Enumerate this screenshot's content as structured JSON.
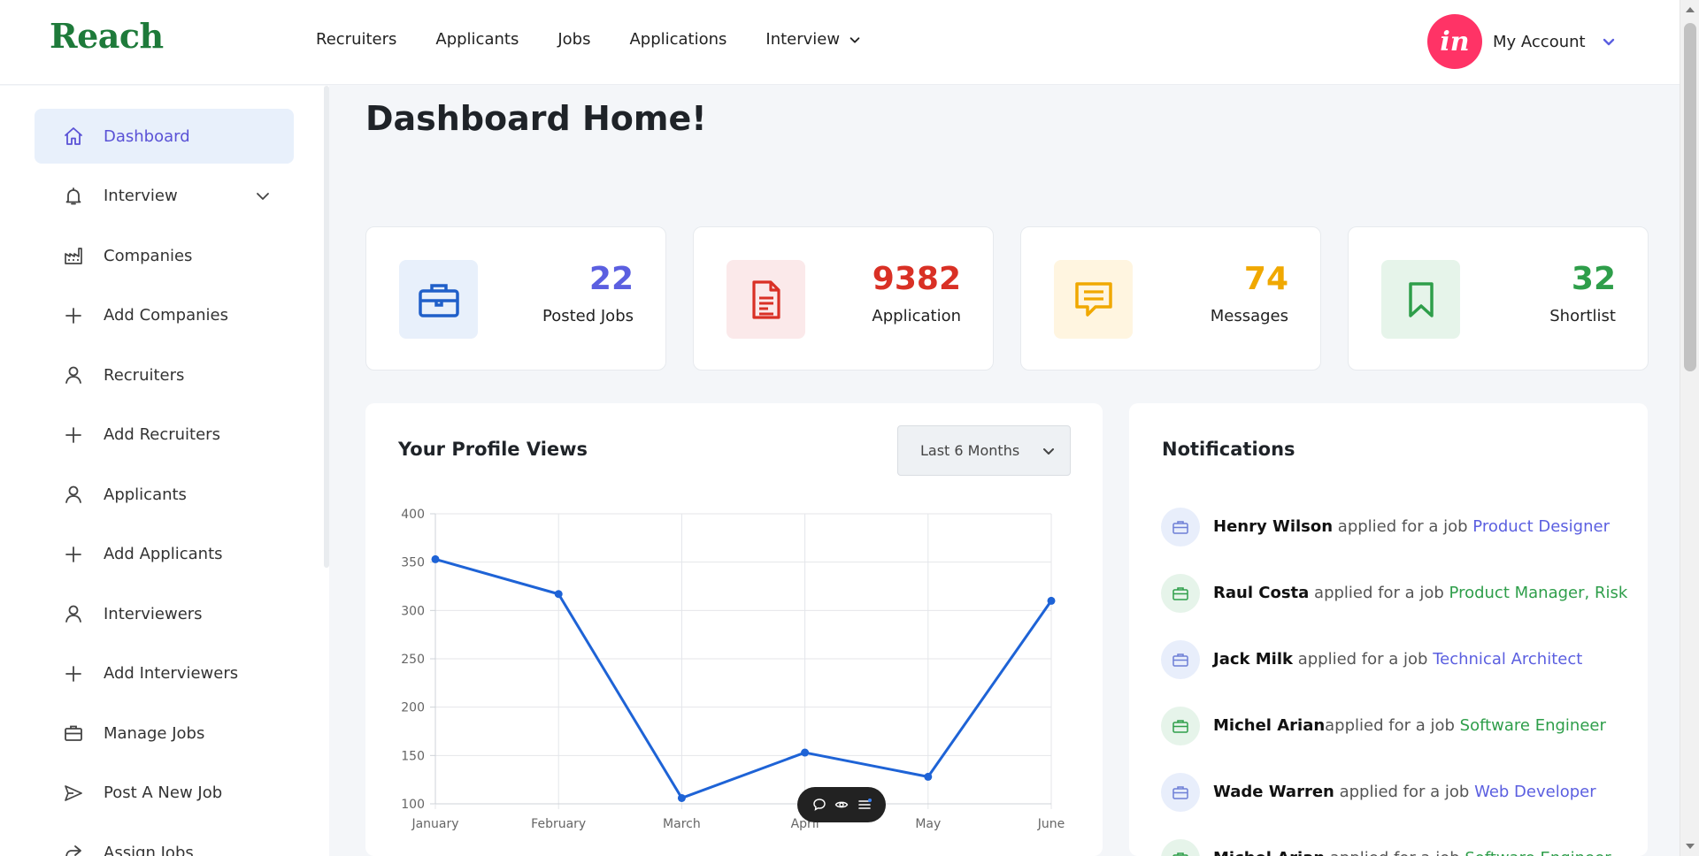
{
  "brand": {
    "logo": "Reach"
  },
  "nav": {
    "items": [
      "Recruiters",
      "Applicants",
      "Jobs",
      "Applications"
    ],
    "interview": "Interview"
  },
  "account": {
    "avatar_text": "in",
    "label": "My Account"
  },
  "sidebar": {
    "items": [
      {
        "label": "Dashboard",
        "icon": "home-icon",
        "active": true
      },
      {
        "label": "Interview",
        "icon": "bell-icon",
        "has_chevron": true
      },
      {
        "label": "Companies",
        "icon": "factory-icon"
      },
      {
        "label": "Add Companies",
        "icon": "plus-icon"
      },
      {
        "label": "Recruiters",
        "icon": "user-icon"
      },
      {
        "label": "Add Recruiters",
        "icon": "plus-icon"
      },
      {
        "label": "Applicants",
        "icon": "user-icon"
      },
      {
        "label": "Add Applicants",
        "icon": "plus-icon"
      },
      {
        "label": "Interviewers",
        "icon": "user-icon"
      },
      {
        "label": "Add Interviewers",
        "icon": "plus-icon"
      },
      {
        "label": "Manage Jobs",
        "icon": "briefcase-icon"
      },
      {
        "label": "Post A New Job",
        "icon": "send-icon"
      },
      {
        "label": "Assign Jobs",
        "icon": "share-icon"
      }
    ]
  },
  "page": {
    "title": "Dashboard Home!"
  },
  "stats": [
    {
      "value": "22",
      "label": "Posted Jobs",
      "icon": "briefcase-icon",
      "color": "#5b5fe0",
      "icon_color": "#1f5fc9",
      "bg": "#e8f0fb"
    },
    {
      "value": "9382",
      "label": "Application",
      "icon": "document-icon",
      "color": "#d93025",
      "icon_color": "#d93025",
      "bg": "#fbe9ea"
    },
    {
      "value": "74",
      "label": "Messages",
      "icon": "message-icon",
      "color": "#f0a800",
      "icon_color": "#f0a800",
      "bg": "#fff5e0"
    },
    {
      "value": "32",
      "label": "Shortlist",
      "icon": "bookmark-icon",
      "color": "#2e9e4a",
      "icon_color": "#2e9e4a",
      "bg": "#e6f4ea"
    }
  ],
  "profile_views": {
    "title": "Your Profile Views",
    "range_label": "Last 6 Months"
  },
  "chart_data": {
    "type": "line",
    "categories": [
      "January",
      "February",
      "March",
      "April",
      "May",
      "June"
    ],
    "series": [
      {
        "values": [
          353,
          317,
          106,
          153,
          128,
          310
        ],
        "color": "#1e63d6"
      }
    ],
    "ylim": [
      100,
      400
    ],
    "yticks": [
      100,
      150,
      200,
      250,
      300,
      350,
      400
    ],
    "grid": true,
    "title": "",
    "xlabel": "",
    "ylabel": ""
  },
  "notifications": {
    "title": "Notifications",
    "items": [
      {
        "name": "Henry Wilson",
        "text": " applied for a job ",
        "job": "Product Designer",
        "color": "#5b5fe0",
        "icon_color": "#6d7fd6",
        "bg": "#e8eefb"
      },
      {
        "name": "Raul Costa",
        "text": " applied for a job ",
        "job": "Product Manager, Risk",
        "color": "#2e9e4a",
        "icon_color": "#2e9e4a",
        "bg": "#e6f4ea"
      },
      {
        "name": "Jack Milk",
        "text": " applied for a job ",
        "job": "Technical Architect",
        "color": "#5b5fe0",
        "icon_color": "#6d7fd6",
        "bg": "#e8eefb"
      },
      {
        "name": "Michel Arian",
        "text": "applied for a job ",
        "job": "Software Engineer",
        "color": "#2e9e4a",
        "icon_color": "#2e9e4a",
        "bg": "#e6f4ea"
      },
      {
        "name": "Wade Warren",
        "text": " applied for a job ",
        "job": "Web Developer",
        "color": "#5b5fe0",
        "icon_color": "#6d7fd6",
        "bg": "#e8eefb"
      },
      {
        "name": "Michel Arian",
        "text": " applied for a job ",
        "job": "Software Engineer",
        "color": "#2e9e4a",
        "icon_color": "#2e9e4a",
        "bg": "#e6f4ea"
      }
    ]
  }
}
